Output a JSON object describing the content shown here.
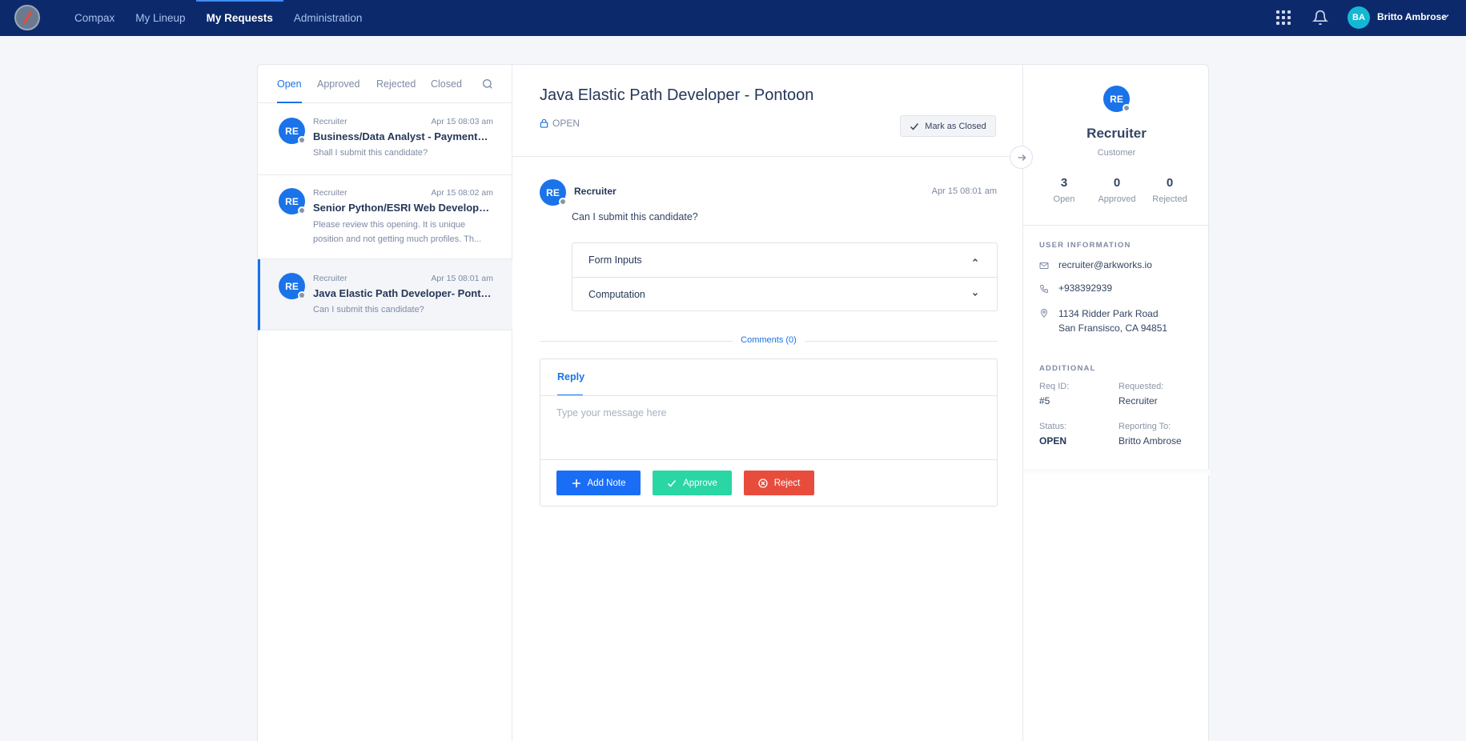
{
  "nav": {
    "items": [
      "Compax",
      "My Lineup",
      "My Requests",
      "Administration"
    ],
    "active": "My Requests"
  },
  "user": {
    "initials": "BA",
    "name": "Britto Ambrose"
  },
  "tabs": [
    "Open",
    "Approved",
    "Rejected",
    "Closed"
  ],
  "requests": [
    {
      "initials": "RE",
      "sender": "Recruiter",
      "time": "Apr 15 08:03 am",
      "title": "Business/Data Analyst - Payments- ...",
      "preview": "Shall I submit this candidate?"
    },
    {
      "initials": "RE",
      "sender": "Recruiter",
      "time": "Apr 15 08:02 am",
      "title": "Senior Python/ESRI Web Developer-...",
      "preview": "Please review this opening. It is unique position and not getting much profiles. Th..."
    },
    {
      "initials": "RE",
      "sender": "Recruiter",
      "time": "Apr 15 08:01 am",
      "title": "Java Elastic Path Developer- Pontoon",
      "preview": "Can I submit this candidate?"
    }
  ],
  "detail": {
    "title": "Java Elastic Path Developer - Pontoon",
    "status": "OPEN",
    "mark_closed_label": "Mark as Closed",
    "message": {
      "initials": "RE",
      "sender": "Recruiter",
      "time": "Apr 15 08:01 am",
      "body": "Can I submit this candidate?"
    },
    "accordion": [
      "Form Inputs",
      "Computation"
    ],
    "comments_label": "Comments (0)",
    "reply_tab": "Reply",
    "reply_placeholder": "Type your message here",
    "buttons": {
      "add_note": "Add Note",
      "approve": "Approve",
      "reject": "Reject"
    }
  },
  "profile": {
    "initials": "RE",
    "name": "Recruiter",
    "role": "Customer",
    "stats": [
      {
        "value": "3",
        "label": "Open"
      },
      {
        "value": "0",
        "label": "Approved"
      },
      {
        "value": "0",
        "label": "Rejected"
      }
    ],
    "user_info_heading": "USER INFORMATION",
    "email": "recruiter@arkworks.io",
    "phone": "+938392939",
    "address_line1": "1134 Ridder Park Road",
    "address_line2": "San Fransisco, CA 94851",
    "additional_heading": "ADDITIONAL",
    "req_id_label": "Req ID:",
    "req_id": "#5",
    "requested_label": "Requested:",
    "requested": "Recruiter",
    "status_label": "Status:",
    "status": "OPEN",
    "reporting_label": "Reporting To:",
    "reporting": "Britto Ambrose"
  },
  "colors": {
    "nav_bg": "#0c2a6b",
    "accent": "#1a73e8",
    "approve": "#29d6a4",
    "reject": "#e84c3d"
  }
}
